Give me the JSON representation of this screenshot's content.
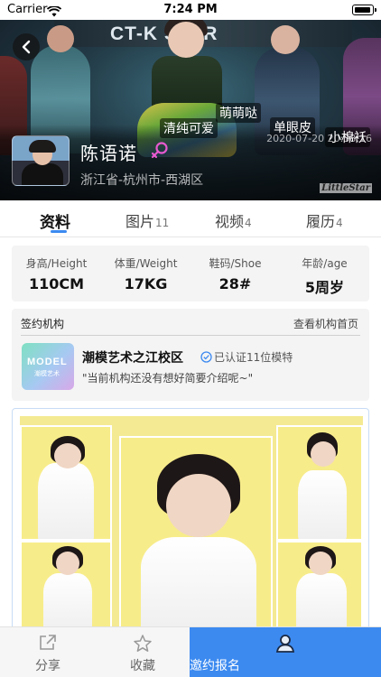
{
  "status_bar": {
    "carrier": "Carrier",
    "time": "7:24 PM"
  },
  "hero": {
    "banner_text": "CT-K   STAR",
    "tags": [
      "萌萌哒",
      "清纯可爱",
      "单眼皮",
      "小棉袄"
    ],
    "timestamp": "2020-07-20 20:38:16",
    "watermark": "LittleStar"
  },
  "profile": {
    "name": "陈语诺",
    "gender_icon": "female-icon",
    "location": "浙江省-杭州市-西湖区"
  },
  "tabs": [
    {
      "label": "资料",
      "count": ""
    },
    {
      "label": "图片",
      "count": "11"
    },
    {
      "label": "视频",
      "count": "4"
    },
    {
      "label": "履历",
      "count": "4"
    }
  ],
  "stats": [
    {
      "label": "身高/Height",
      "value": "110CM"
    },
    {
      "label": "体重/Weight",
      "value": "17KG"
    },
    {
      "label": "鞋码/Shoe",
      "value": "28#"
    },
    {
      "label": "年龄/age",
      "value": "5周岁"
    }
  ],
  "agency": {
    "title": "签约机构",
    "link": "查看机构首页",
    "logo_text": "MODEL",
    "logo_sub": "潮模艺术",
    "name": "潮模艺术之江校区",
    "verified": "已认证11位模特",
    "description": "\"当前机构还没有想好简要介绍呢~\""
  },
  "bottom_bar": {
    "share": "分享",
    "favorite": "收藏",
    "invite": "邀约报名"
  },
  "colors": {
    "accent": "#3c8af0",
    "gender": "#e85ad0"
  }
}
